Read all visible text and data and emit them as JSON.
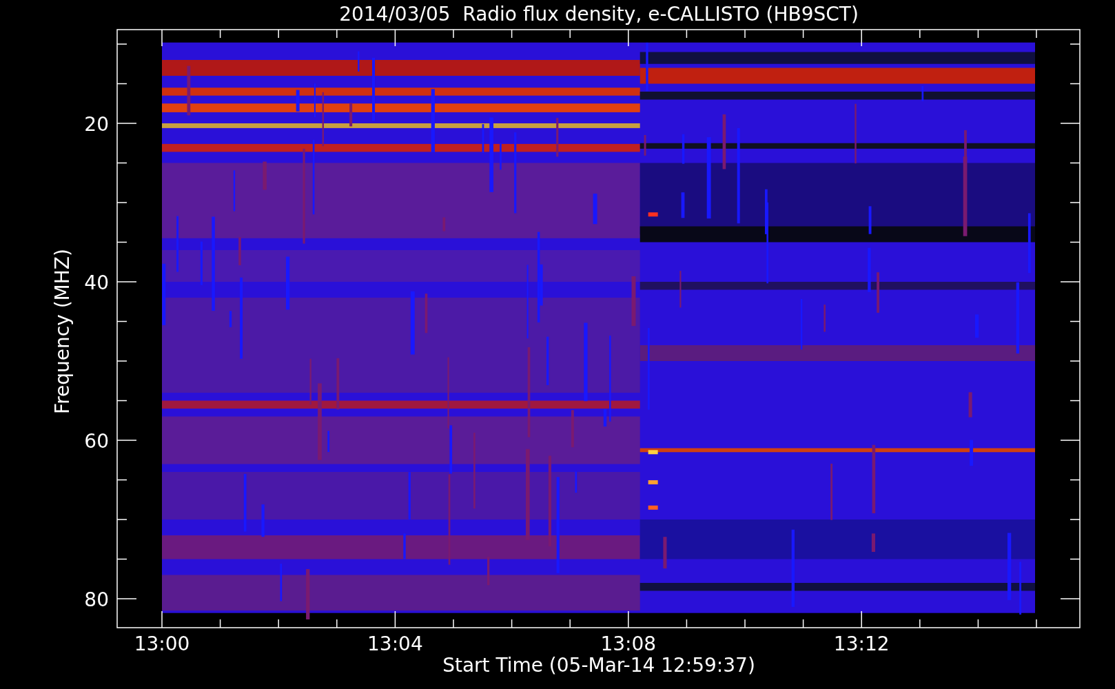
{
  "plot": {
    "title": "2014/03/05  Radio flux density, e-CALLISTO (HB9SCT)",
    "ylabel": "Frequency (MHZ)",
    "xlabel": "Start Time (05-Mar-14 12:59:37)",
    "yticks": [
      "20",
      "40",
      "60",
      "80"
    ],
    "xticks": [
      "13:00",
      "13:04",
      "13:08",
      "13:12"
    ]
  }
}
